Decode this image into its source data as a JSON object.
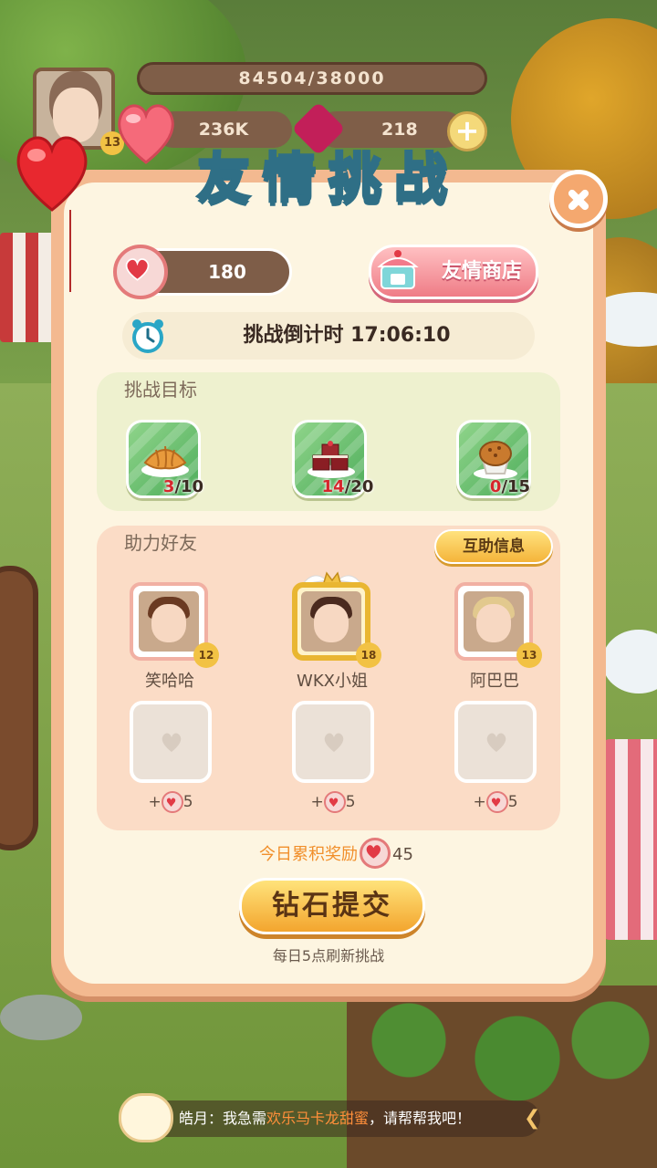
{
  "hud": {
    "exp_text": "84504/38000",
    "coins": "236K",
    "gems": "218",
    "player_level": "13"
  },
  "dialog": {
    "title": "友情挑战",
    "hearts": "180",
    "shop_label": "友情商店",
    "countdown": "挑战倒计时 17:06:10"
  },
  "goals": {
    "title": "挑战目标",
    "items": [
      {
        "name": "croissant",
        "current": "3",
        "total": "/10"
      },
      {
        "name": "red-velvet-cake",
        "current": "14",
        "total": "/20"
      },
      {
        "name": "muffin",
        "current": "0",
        "total": "/15"
      }
    ]
  },
  "helpers": {
    "title": "助力好友",
    "mutual_button": "互助信息",
    "friends": [
      {
        "name": "笑哈哈",
        "level": "12"
      },
      {
        "name": "WKX小姐",
        "level": "18"
      },
      {
        "name": "阿巴巴",
        "level": "13"
      }
    ],
    "slot_rewards": [
      {
        "prefix": "+",
        "amount": "5"
      },
      {
        "prefix": "+",
        "amount": "5"
      },
      {
        "prefix": "+",
        "amount": "5"
      }
    ]
  },
  "footer": {
    "daily_total_label": "今日累积奖励",
    "daily_total_value": "45",
    "submit_label": "钻石提交",
    "refresh_note": "每日5点刷新挑战"
  },
  "chat": {
    "speaker": "皓月：我急需",
    "highlight": "欢乐马卡龙甜蜜",
    "suffix": "，请帮帮我吧！"
  },
  "colors": {
    "title_fill": "#6fd3d7",
    "accent_red": "#d6262c",
    "dialog_border": "#f3b990"
  }
}
